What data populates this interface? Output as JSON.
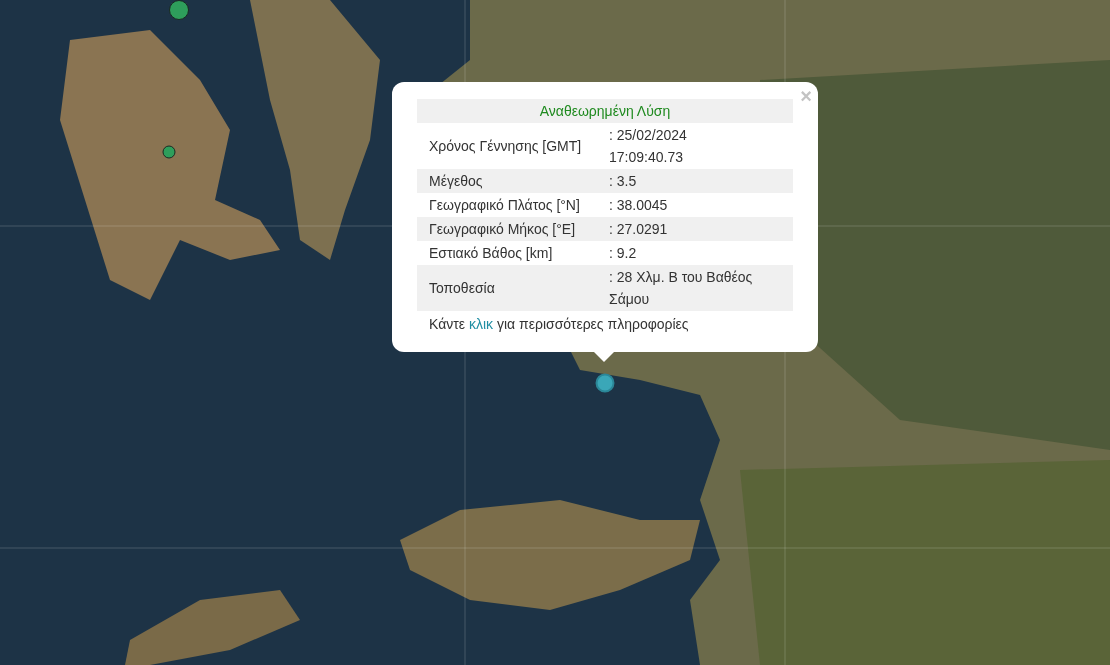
{
  "map": {
    "markers": [
      {
        "kind": "large",
        "color": "#2e9e5b"
      },
      {
        "kind": "small",
        "color": "#2e9e5b"
      },
      {
        "kind": "selected",
        "color": "#3aa7b8"
      }
    ]
  },
  "popup": {
    "title": "Αναθεωρημένη Λύση",
    "close": "×",
    "rows": [
      {
        "label": "Χρόνος Γέννησης [GMT]",
        "value": ": 25/02/2024 17:09:40.73"
      },
      {
        "label": "Μέγεθος",
        "value": ": 3.5"
      },
      {
        "label": "Γεωγραφικό Πλάτος [°N]",
        "value": ": 38.0045"
      },
      {
        "label": "Γεωγραφικό Μήκος [°E]",
        "value": ": 27.0291"
      },
      {
        "label": "Εστιακό Βάθος [km]",
        "value": ": 9.2"
      },
      {
        "label": "Τοποθεσία",
        "value": ": 28 Χλμ. Β του Βαθέος Σάμου"
      }
    ],
    "footer": {
      "before": "Κάντε ",
      "link": "κλικ",
      "after": " για περισσότερες πληροφορίες"
    }
  }
}
